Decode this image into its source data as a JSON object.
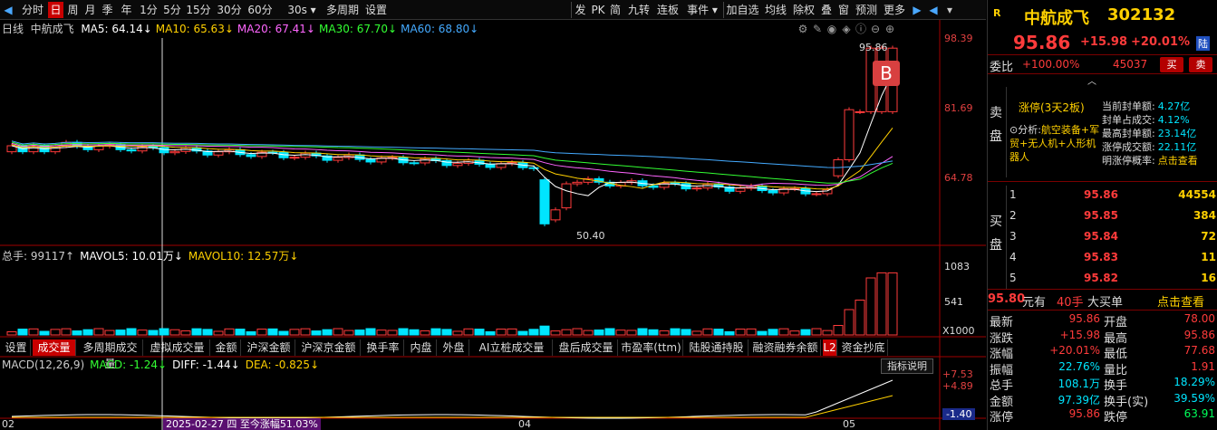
{
  "toolbar": {
    "left": [
      "分时",
      "日",
      "周",
      "月",
      "季",
      "年",
      "1分",
      "5分",
      "15分",
      "30分",
      "60分",
      "30s ▾",
      "多周期",
      "设置"
    ],
    "right": [
      "发",
      "PK",
      "简",
      "九转",
      "连板",
      "事件 ▾",
      "加自选",
      "均线",
      "除权",
      "叠",
      "窗",
      "预测",
      "更多"
    ]
  },
  "chart": {
    "period": "日线",
    "stock": "中航成飞",
    "ma": [
      {
        "label": "MA5: 64.14↓",
        "color": "#ffffff"
      },
      {
        "label": "MA10: 65.63↓",
        "color": "#ffd000"
      },
      {
        "label": "MA20: 67.41↓",
        "color": "#ff66ff"
      },
      {
        "label": "MA30: 67.70↓",
        "color": "#33ff33"
      },
      {
        "label": "MA60: 68.80↓",
        "color": "#44aaff"
      }
    ],
    "y_ticks": [
      "98.39",
      "81.69",
      "64.78"
    ],
    "high_label": "95.86",
    "low_label": "50.40",
    "signal": "B",
    "vol_legend": [
      {
        "label": "总手: 99117↑",
        "color": "#cccccc"
      },
      {
        "label": "MAVOL5: 10.01万↓",
        "color": "#ffffff"
      },
      {
        "label": "MAVOL10: 12.57万↓",
        "color": "#ffd000"
      }
    ],
    "vol_ticks": [
      "1083",
      "541",
      "X1000"
    ],
    "tabs": [
      "设置",
      "成交量",
      "多周期成交量",
      "虚拟成交量",
      "金额",
      "沪深金额",
      "沪深京金额",
      "换手率",
      "内盘",
      "外盘",
      "AI立桩成交量",
      "盘后成交量",
      "市盈率(ttm)",
      "陆股通持股",
      "融资融券余额",
      "L2",
      "资金抄底"
    ],
    "active_tab": "成交量",
    "macd_legend": [
      {
        "label": "MACD(12,26,9)",
        "color": "#cccccc"
      },
      {
        "label": "MACD: -1.24↓",
        "color": "#33ff33"
      },
      {
        "label": "DIFF: -1.44↓",
        "color": "#ffffff"
      },
      {
        "label": "DEA: -0.825↓",
        "color": "#ffd000"
      }
    ],
    "macd_ticks": [
      "+7.53",
      "+4.89",
      "-1.40"
    ],
    "indicator_btn": "指标说明",
    "x_labels": [
      "02",
      "04",
      "05"
    ],
    "date_note": "2025-02-27 四 至今涨幅51.03%"
  },
  "quote": {
    "logo": "R",
    "name": "中航成飞",
    "code": "302132",
    "price": "95.86",
    "change": "+15.98",
    "pct": "+20.01%",
    "tag": "陆",
    "weibi_label": "委比",
    "weibi": "+100.00%",
    "weicha": "45037",
    "buy_btn": "买",
    "sell_btn": "卖",
    "limit_title": "涨停(3天2板)",
    "analysis_label": "分析:",
    "analysis": "航空装备+军贸+无人机+人形机器人",
    "stats": [
      {
        "k": "当前封单额:",
        "v": "4.27亿"
      },
      {
        "k": "封单占成交:",
        "v": "4.12%"
      },
      {
        "k": "最高封单额:",
        "v": "23.14亿"
      },
      {
        "k": "涨停成交额:",
        "v": "22.11亿"
      },
      {
        "k": "明涨停概率:",
        "v": "点击查看"
      }
    ],
    "sell_side": [
      "卖",
      "盘"
    ],
    "buy_side": [
      "买",
      "盘"
    ],
    "book": [
      {
        "lv": "1",
        "p": "95.86",
        "v": "44554"
      },
      {
        "lv": "2",
        "p": "95.85",
        "v": "384"
      },
      {
        "lv": "3",
        "p": "95.84",
        "v": "72"
      },
      {
        "lv": "4",
        "p": "95.83",
        "v": "11"
      },
      {
        "lv": "5",
        "p": "95.82",
        "v": "16"
      }
    ],
    "bigbuy": {
      "price": "95.80",
      "t1": "元有",
      "lots": "40手",
      "t2": "大买单",
      "link": "点击查看"
    },
    "details": [
      {
        "k1": "最新",
        "v1": "95.86",
        "k2": "开盘",
        "v2": "78.00"
      },
      {
        "k1": "涨跌",
        "v1": "+15.98",
        "k2": "最高",
        "v2": "95.86"
      },
      {
        "k1": "涨幅",
        "v1": "+20.01%",
        "k2": "最低",
        "v2": "77.68"
      },
      {
        "k1": "振幅",
        "v1": "22.76%",
        "k2": "量比",
        "v2": "1.91"
      },
      {
        "k1": "总手",
        "v1": "108.1万",
        "k2": "换手",
        "v2": "18.29%"
      },
      {
        "k1": "金额",
        "v1": "97.39亿",
        "k2": "换手(实)",
        "v2": "39.59%"
      },
      {
        "k1": "涨停",
        "v1": "95.86",
        "k2": "跌停",
        "v2": "63.91"
      }
    ]
  }
}
